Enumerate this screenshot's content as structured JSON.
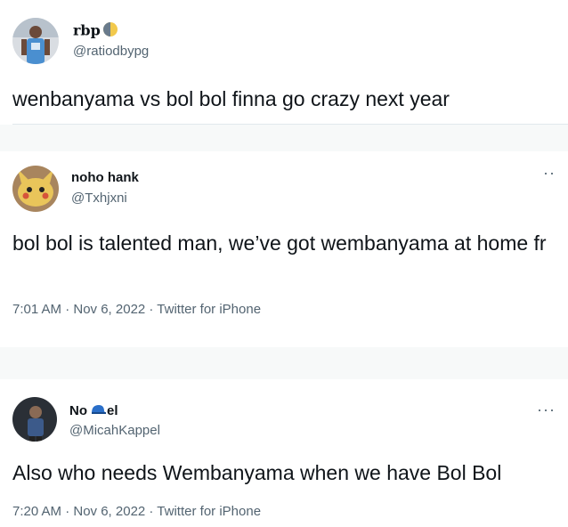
{
  "tweets": [
    {
      "display_name": "rbp",
      "handle": "@ratiodbypg",
      "text": "wenbanyama vs bol bol finna go crazy next year",
      "name_icon": "half-moon-icon"
    },
    {
      "display_name": "noho hank",
      "handle": "@Txhjxni",
      "text": "bol bol is talented man, we’ve got wembanyama at home fr",
      "meta": "7:01 AM · Nov 6, 2022 · Twitter for iPhone",
      "more": "··"
    },
    {
      "display_name_a": "No",
      "display_name_b": "el",
      "name_icon": "blue-cap-icon",
      "handle": "@MicahKappel",
      "text": "Also who needs Wembanyama when we have Bol Bol",
      "meta": "7:20 AM · Nov 6, 2022 · Twitter for iPhone",
      "more": "···"
    }
  ],
  "colors": {
    "text_primary": "#0f1419",
    "text_secondary": "#536471",
    "separator_bg": "#f7f9f9",
    "divider": "#e1e8ed"
  }
}
